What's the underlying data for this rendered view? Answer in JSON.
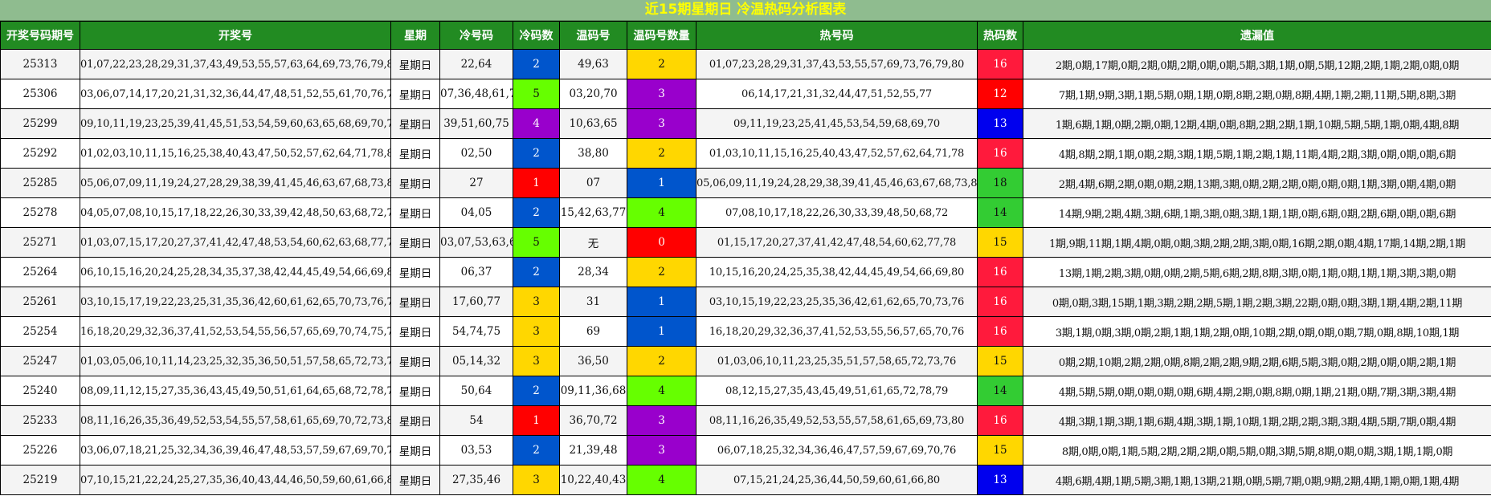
{
  "title": "近15期星期日 冷温热码分析图表",
  "headers": [
    "开奖号码期号",
    "开奖号",
    "星期",
    "冷号码",
    "冷码数",
    "温码号",
    "温码号数量",
    "热号码",
    "热码数",
    "遗漏值"
  ],
  "colors": {
    "blue": "#0055cc",
    "green": "#66ff00",
    "purple": "#9900cc",
    "red": "#ff0000",
    "gold": "#ffd700",
    "crimson": "#ff1a3c",
    "lime": "#33cc33",
    "navy": "#0000ee"
  },
  "rows": [
    {
      "issue": "25313",
      "numbers": "01,07,22,23,28,29,31,37,43,49,53,55,57,63,64,69,73,76,79,80",
      "weekday": "星期日",
      "cold": "22,64",
      "cold_count": "2",
      "cold_color": "blue",
      "warm": "49,63",
      "warm_count": "2",
      "warm_color": "gold",
      "hot": "01,07,23,28,29,31,37,43,53,55,57,69,73,76,79,80",
      "hot_count": "16",
      "hot_color": "crimson",
      "omission": "2期,0期,17期,0期,2期,0期,2期,0期,0期,5期,3期,1期,0期,5期,12期,2期,1期,2期,0期,0期"
    },
    {
      "issue": "25306",
      "numbers": "03,06,07,14,17,20,21,31,32,36,44,47,48,51,52,55,61,70,76,77",
      "weekday": "星期日",
      "cold": "07,36,48,61,76",
      "cold_count": "5",
      "cold_color": "green",
      "warm": "03,20,70",
      "warm_count": "3",
      "warm_color": "purple",
      "hot": "06,14,17,21,31,32,44,47,51,52,55,77",
      "hot_count": "12",
      "hot_color": "red",
      "omission": "7期,1期,9期,3期,1期,5期,0期,1期,0期,8期,2期,0期,8期,4期,1期,2期,11期,5期,8期,3期"
    },
    {
      "issue": "25299",
      "numbers": "09,10,11,19,23,25,39,41,45,51,53,54,59,60,63,65,68,69,70,75",
      "weekday": "星期日",
      "cold": "39,51,60,75",
      "cold_count": "4",
      "cold_color": "purple",
      "warm": "10,63,65",
      "warm_count": "3",
      "warm_color": "purple",
      "hot": "09,11,19,23,25,41,45,53,54,59,68,69,70",
      "hot_count": "13",
      "hot_color": "navy",
      "omission": "1期,6期,1期,0期,2期,0期,12期,4期,0期,8期,2期,2期,1期,10期,5期,5期,1期,0期,4期,8期"
    },
    {
      "issue": "25292",
      "numbers": "01,02,03,10,11,15,16,25,38,40,43,47,50,52,57,62,64,71,78,80",
      "weekday": "星期日",
      "cold": "02,50",
      "cold_count": "2",
      "cold_color": "blue",
      "warm": "38,80",
      "warm_count": "2",
      "warm_color": "gold",
      "hot": "01,03,10,11,15,16,25,40,43,47,52,57,62,64,71,78",
      "hot_count": "16",
      "hot_color": "crimson",
      "omission": "4期,8期,2期,1期,0期,2期,3期,1期,5期,1期,2期,1期,11期,4期,2期,3期,0期,0期,0期,6期"
    },
    {
      "issue": "25285",
      "numbers": "05,06,07,09,11,19,24,27,28,29,38,39,41,45,46,63,67,68,73,80",
      "weekday": "星期日",
      "cold": "27",
      "cold_count": "1",
      "cold_color": "red",
      "warm": "07",
      "warm_count": "1",
      "warm_color": "blue",
      "hot": "05,06,09,11,19,24,28,29,38,39,41,45,46,63,67,68,73,80",
      "hot_count": "18",
      "hot_color": "lime",
      "omission": "2期,4期,6期,2期,0期,0期,2期,13期,3期,0期,2期,2期,0期,0期,0期,1期,3期,0期,4期,0期"
    },
    {
      "issue": "25278",
      "numbers": "04,05,07,08,10,15,17,18,22,26,30,33,39,42,48,50,63,68,72,77",
      "weekday": "星期日",
      "cold": "04,05",
      "cold_count": "2",
      "cold_color": "blue",
      "warm": "15,42,63,77",
      "warm_count": "4",
      "warm_color": "green",
      "hot": "07,08,10,17,18,22,26,30,33,39,48,50,68,72",
      "hot_count": "14",
      "hot_color": "lime",
      "omission": "14期,9期,2期,4期,3期,6期,1期,3期,0期,3期,1期,1期,0期,6期,0期,2期,6期,0期,0期,6期"
    },
    {
      "issue": "25271",
      "numbers": "01,03,07,15,17,20,27,37,41,42,47,48,53,54,60,62,63,68,77,78",
      "weekday": "星期日",
      "cold": "03,07,53,63,68",
      "cold_count": "5",
      "cold_color": "green",
      "warm": "无",
      "warm_count": "0",
      "warm_color": "red",
      "hot": "01,15,17,20,27,37,41,42,47,48,54,60,62,77,78",
      "hot_count": "15",
      "hot_color": "gold",
      "omission": "1期,9期,11期,1期,4期,0期,0期,3期,2期,2期,3期,0期,16期,2期,0期,4期,17期,14期,2期,1期"
    },
    {
      "issue": "25264",
      "numbers": "06,10,15,16,20,24,25,28,34,35,37,38,42,44,45,49,54,66,69,80",
      "weekday": "星期日",
      "cold": "06,37",
      "cold_count": "2",
      "cold_color": "blue",
      "warm": "28,34",
      "warm_count": "2",
      "warm_color": "gold",
      "hot": "10,15,16,20,24,25,35,38,42,44,45,49,54,66,69,80",
      "hot_count": "16",
      "hot_color": "crimson",
      "omission": "13期,1期,2期,3期,0期,0期,2期,5期,6期,2期,8期,3期,0期,1期,0期,1期,1期,3期,3期,0期"
    },
    {
      "issue": "25261",
      "numbers": "03,10,15,17,19,22,23,25,31,35,36,42,60,61,62,65,70,73,76,77",
      "weekday": "星期日",
      "cold": "17,60,77",
      "cold_count": "3",
      "cold_color": "gold",
      "warm": "31",
      "warm_count": "1",
      "warm_color": "blue",
      "hot": "03,10,15,19,22,23,25,35,36,42,61,62,65,70,73,76",
      "hot_count": "16",
      "hot_color": "crimson",
      "omission": "0期,0期,3期,15期,1期,3期,2期,2期,5期,1期,2期,3期,22期,0期,0期,3期,1期,4期,2期,11期"
    },
    {
      "issue": "25254",
      "numbers": "16,18,20,29,32,36,37,41,52,53,54,55,56,57,65,69,70,74,75,76",
      "weekday": "星期日",
      "cold": "54,74,75",
      "cold_count": "3",
      "cold_color": "gold",
      "warm": "69",
      "warm_count": "1",
      "warm_color": "blue",
      "hot": "16,18,20,29,32,36,37,41,52,53,55,56,57,65,70,76",
      "hot_count": "16",
      "hot_color": "crimson",
      "omission": "3期,1期,0期,3期,0期,2期,1期,1期,2期,0期,10期,2期,0期,0期,0期,7期,0期,8期,10期,1期"
    },
    {
      "issue": "25247",
      "numbers": "01,03,05,06,10,11,14,23,25,32,35,36,50,51,57,58,65,72,73,76",
      "weekday": "星期日",
      "cold": "05,14,32",
      "cold_count": "3",
      "cold_color": "gold",
      "warm": "36,50",
      "warm_count": "2",
      "warm_color": "gold",
      "hot": "01,03,06,10,11,23,25,35,51,57,58,65,72,73,76",
      "hot_count": "15",
      "hot_color": "gold",
      "omission": "0期,2期,10期,2期,2期,0期,8期,2期,2期,9期,2期,6期,5期,3期,0期,2期,0期,0期,2期,1期"
    },
    {
      "issue": "25240",
      "numbers": "08,09,11,12,15,27,35,36,43,45,49,50,51,61,64,65,68,72,78,79",
      "weekday": "星期日",
      "cold": "50,64",
      "cold_count": "2",
      "cold_color": "blue",
      "warm": "09,11,36,68",
      "warm_count": "4",
      "warm_color": "green",
      "hot": "08,12,15,27,35,43,45,49,51,61,65,72,78,79",
      "hot_count": "14",
      "hot_color": "lime",
      "omission": "4期,5期,5期,0期,0期,0期,0期,6期,4期,2期,0期,8期,0期,1期,21期,0期,7期,3期,3期,4期"
    },
    {
      "issue": "25233",
      "numbers": "08,11,16,26,35,36,49,52,53,54,55,57,58,61,65,69,70,72,73,80",
      "weekday": "星期日",
      "cold": "54",
      "cold_count": "1",
      "cold_color": "red",
      "warm": "36,70,72",
      "warm_count": "3",
      "warm_color": "purple",
      "hot": "08,11,16,26,35,49,52,53,55,57,58,61,65,69,73,80",
      "hot_count": "16",
      "hot_color": "crimson",
      "omission": "4期,3期,1期,3期,1期,6期,4期,3期,1期,10期,1期,2期,2期,3期,3期,4期,5期,7期,0期,4期"
    },
    {
      "issue": "25226",
      "numbers": "03,06,07,18,21,25,32,34,36,39,46,47,48,53,57,59,67,69,70,76",
      "weekday": "星期日",
      "cold": "03,53",
      "cold_count": "2",
      "cold_color": "blue",
      "warm": "21,39,48",
      "warm_count": "3",
      "warm_color": "purple",
      "hot": "06,07,18,25,32,34,36,46,47,57,59,67,69,70,76",
      "hot_count": "15",
      "hot_color": "gold",
      "omission": "8期,0期,0期,1期,5期,2期,2期,2期,0期,5期,0期,3期,5期,8期,0期,0期,3期,1期,1期,0期"
    },
    {
      "issue": "25219",
      "numbers": "07,10,15,21,22,24,25,27,35,36,40,43,44,46,50,59,60,61,66,80",
      "weekday": "星期日",
      "cold": "27,35,46",
      "cold_count": "3",
      "cold_color": "gold",
      "warm": "10,22,40,43",
      "warm_count": "4",
      "warm_color": "green",
      "hot": "07,15,21,24,25,36,44,50,59,60,61,66,80",
      "hot_count": "13",
      "hot_color": "navy",
      "omission": "4期,6期,4期,1期,5期,3期,1期,13期,21期,0期,5期,7期,0期,9期,2期,4期,1期,0期,1期,4期"
    }
  ]
}
